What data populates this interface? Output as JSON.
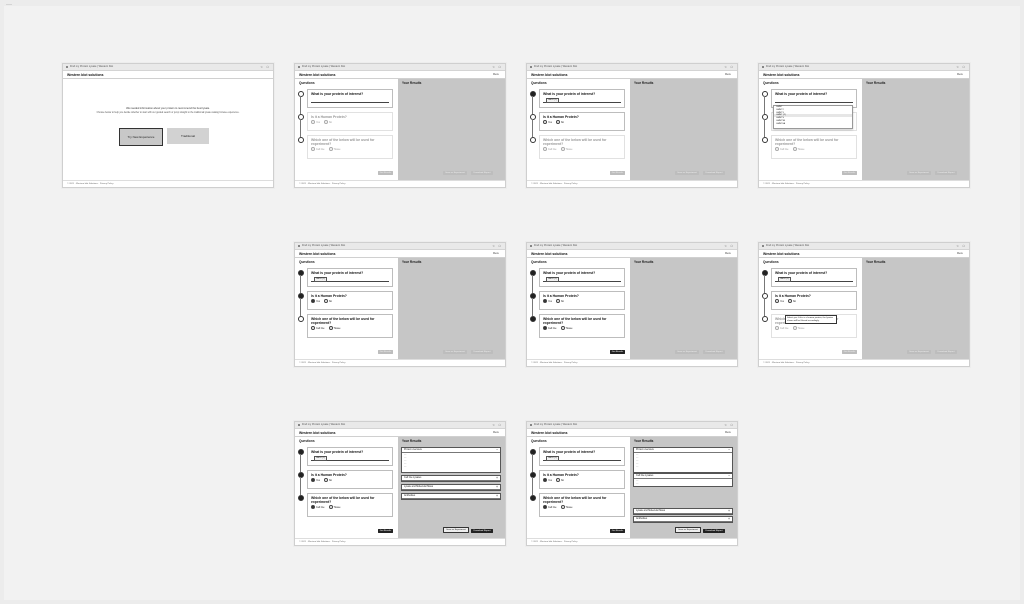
{
  "canvas_label": "——",
  "app": {
    "tab_title": "Find my Protein Lysate",
    "tab_page": "Western blot",
    "brand": "Western blot solutions",
    "menu": "Menu",
    "footer": "© 2021 · Western blot Solutions · Privacy Policy"
  },
  "landing": {
    "line1": "We needed information about your protein to recommend the best lysate.",
    "line2": "Choose below to help you decide whether to start with our guided search or jump straight to the traditional lysate catalog browse experience.",
    "btn_new": "Try New Experience",
    "btn_traditional": "Traditional"
  },
  "labels": {
    "questions": "Questions",
    "results": "Your Results",
    "q1": "What is your protein of interest?",
    "q2": "Is it a Human Protein?",
    "q3": "Which one of the below will be used for experiment?",
    "yes": "Yes",
    "no": "No",
    "cell_line": "Cell line",
    "tissue": "Tissue",
    "chip": "GMNT (2)",
    "get_results": "Get Results",
    "save_experiment": "Save as Experiment",
    "download_report": "Download Report",
    "result_top": "Protein overview",
    "result_a": "Cell line Lysates",
    "result_b": "Lysate and Molecular Mass",
    "result_c": "Antibodies",
    "tooltip": "Select yes if this is a human protein; the lysates shown will be filtered accordingly.",
    "dropdown": [
      "GMNT",
      "GMNT2",
      "GMNT3",
      "GMNT (2)",
      "GMNTS",
      "GMNT5B",
      "GMNT6A"
    ]
  }
}
